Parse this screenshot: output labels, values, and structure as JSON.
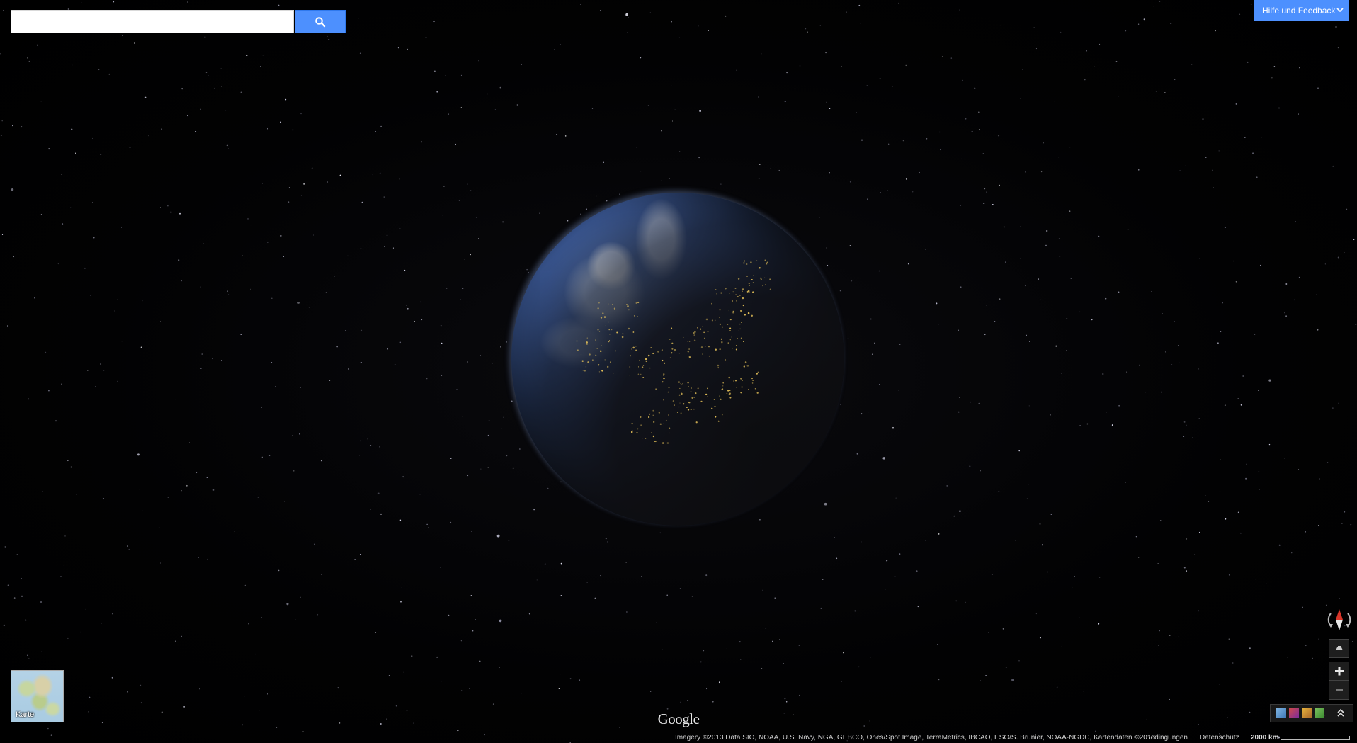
{
  "search": {
    "placeholder": "",
    "value": "",
    "icon": "search-icon"
  },
  "help": {
    "label": "Hilfe und Feedback",
    "icon": "chevron-down-icon"
  },
  "map_type": {
    "label": "Karte"
  },
  "controls": {
    "compass_icon": "compass-icon",
    "tilt_icon": "tilt-icon",
    "zoom_in_icon": "plus-icon",
    "zoom_out_icon": "minus-icon",
    "layers_expand_icon": "double-chevron-up-icon"
  },
  "logo": {
    "text": "Google"
  },
  "footer": {
    "attribution": "Imagery ©2013 Data SIO, NOAA, U.S. Navy, NGA, GEBCO, Ones/Spot Image, TerraMetrics, IBCAO, ESO/S. Brunier, NOAA-NGDC, Kartendaten ©2013",
    "terms": "Bedingungen",
    "privacy": "Datenschutz",
    "scale": "2000 km"
  },
  "colors": {
    "accent": "#4d90fe",
    "background": "#000000"
  }
}
